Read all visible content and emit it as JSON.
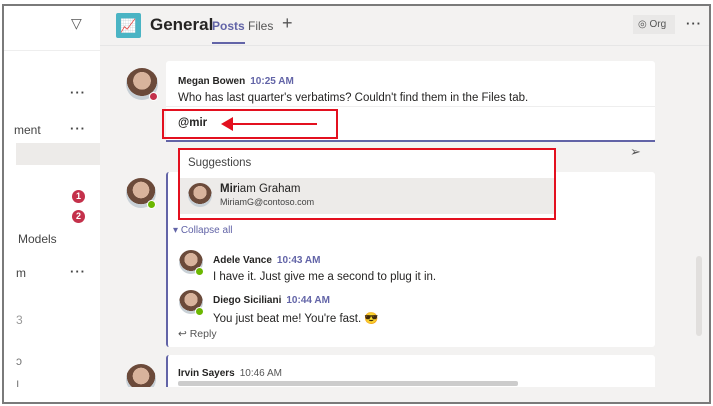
{
  "sidebar": {
    "items": [
      "ment",
      "Models",
      "m",
      "3",
      "ɔ",
      "ı"
    ],
    "badges": [
      "1",
      "2"
    ]
  },
  "header": {
    "title": "General",
    "tabs": [
      "Posts",
      "Files"
    ],
    "add": "+",
    "org": "Org"
  },
  "thread": {
    "author": "Megan Bowen",
    "time": "10:25 AM",
    "text": "Who has last quarter's verbatims? Couldn't find them in the Files tab.",
    "compose_value": "@mir",
    "suggestions": {
      "title": "Suggestions",
      "items": [
        {
          "match": "Mir",
          "rest": "iam Graham",
          "email": "MiriamG@contoso.com"
        }
      ]
    }
  },
  "thread2": {
    "collapse": "Collapse all",
    "replies": [
      {
        "author": "Adele Vance",
        "time": "10:43 AM",
        "text": "I have it. Just give me a second to plug it in."
      },
      {
        "author": "Diego Siciliani",
        "time": "10:44 AM",
        "text": "You just beat me! You're fast.",
        "emoji": "😎"
      }
    ],
    "reply": "Reply"
  },
  "thread3": {
    "author": "Irvin Sayers",
    "time": "10:46 AM"
  },
  "colors": {
    "accent": "#6264a7",
    "highlight": "#e3101f",
    "badge": "#c4314b",
    "available": "#6bb700"
  }
}
